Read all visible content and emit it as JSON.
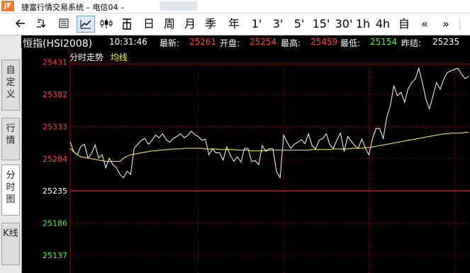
{
  "window": {
    "title": "捷富行情交易系统 – 电信04 – ",
    "logo": "JF"
  },
  "toolbar": {
    "items": [
      {
        "name": "back-arrow-icon",
        "label": "←"
      },
      {
        "name": "shortcut-icon",
        "label": ""
      },
      {
        "name": "list-icon",
        "label": ""
      },
      {
        "name": "minute-chart-icon",
        "label": ""
      },
      {
        "name": "kline-icon",
        "label": ""
      },
      {
        "name": "quote-icon",
        "label": ""
      },
      {
        "name": "day-button",
        "label": "日"
      },
      {
        "name": "week-button",
        "label": "周"
      },
      {
        "name": "month-button",
        "label": "月"
      },
      {
        "name": "season-button",
        "label": "季"
      },
      {
        "name": "year-button",
        "label": "年"
      },
      {
        "name": "1min-button",
        "label": "1'"
      },
      {
        "name": "3min-button",
        "label": "3'"
      },
      {
        "name": "5min-button",
        "label": "5'"
      },
      {
        "name": "15min-button",
        "label": "15'"
      },
      {
        "name": "30min-button",
        "label": "30'"
      },
      {
        "name": "1h-button",
        "label": "1h"
      },
      {
        "name": "4h-button",
        "label": "4h"
      },
      {
        "name": "custom-button",
        "label": "自"
      },
      {
        "name": "prev-icon",
        "label": "«"
      },
      {
        "name": "next-icon",
        "label": "»"
      }
    ]
  },
  "info": {
    "instrument": "恒指(HSI2008)",
    "time": "10:31:46",
    "latest_label": "最新:",
    "latest": "25261",
    "open_label": "开盘:",
    "open": "25254",
    "high_label": "最高:",
    "high": "25459",
    "low_label": "最低:",
    "low": "25154",
    "prev_close_label": "昨结:",
    "prev_close": "25235"
  },
  "subheader": {
    "title": "分时走势",
    "avg_label": "均线"
  },
  "sidebar": {
    "tabs": [
      {
        "label": "自定义",
        "active": false
      },
      {
        "label": "行情",
        "active": false
      },
      {
        "label": "分时图",
        "active": true
      },
      {
        "label": "K线",
        "active": false
      }
    ]
  },
  "colors": {
    "up": "#ff4040",
    "down": "#40ff40",
    "neutral": "#ffffff",
    "price_line": "#ffffff",
    "avg_line": "#ffff40",
    "grid": "#a00000",
    "baseline": "#ff0000"
  },
  "chart_data": {
    "type": "line",
    "ylim": [
      25110,
      25448
    ],
    "y_ticks": [
      "25431",
      "25382",
      "25333",
      "25284",
      "25235",
      "25186",
      "25137"
    ],
    "y_tick_values": [
      25431,
      25382,
      25333,
      25284,
      25235,
      25186,
      25137
    ],
    "baseline": 25235,
    "x": [
      0,
      5,
      10,
      15,
      20,
      25,
      30,
      35,
      40,
      45,
      50,
      55,
      60,
      65,
      70,
      75,
      80,
      85,
      90,
      95,
      100,
      105,
      110,
      115,
      120,
      125,
      130,
      135,
      140,
      145,
      150,
      155,
      160,
      165,
      170,
      175,
      180,
      185,
      190,
      195,
      200,
      205,
      210,
      215,
      220,
      225,
      230,
      235,
      240,
      245,
      250,
      255,
      260,
      265,
      270,
      275,
      280,
      285,
      290,
      295,
      300,
      305,
      310,
      315,
      320,
      325,
      330,
      335,
      340,
      345,
      350,
      355,
      360,
      365,
      370,
      375,
      380,
      385,
      390,
      395,
      400,
      405,
      410,
      415,
      420,
      425,
      430,
      435,
      440,
      445,
      450,
      455,
      460,
      465,
      470,
      475,
      480,
      485,
      490,
      495,
      500,
      505,
      510,
      515,
      520,
      525,
      530,
      535,
      540,
      545,
      550,
      555,
      560
    ],
    "series": [
      {
        "values": [
          25310,
          25295,
          25290,
          25303,
          25306,
          25285,
          25292,
          25305,
          25285,
          25290,
          25270,
          25285,
          25275,
          25270,
          25260,
          25255,
          25265,
          25260,
          25300,
          25306,
          25312,
          25315,
          25306,
          25312,
          25320,
          25316,
          25322,
          25313,
          25309,
          25315,
          25318,
          25322,
          25316,
          25319,
          25326,
          25321,
          25318,
          25312,
          25314,
          25290,
          25299,
          25293,
          25293,
          25282,
          25302,
          25290,
          25280,
          25287,
          25279,
          25300,
          25300,
          25280,
          25281,
          25275,
          25304,
          25295,
          25300,
          25299,
          25265,
          25255,
          25320,
          25309,
          25300,
          25306,
          25309,
          25313,
          25307,
          25322,
          25304,
          25299,
          25312,
          25315,
          25322,
          25305,
          25300,
          25313,
          25323,
          25295,
          25318,
          25311,
          25304,
          25300,
          25314,
          25300,
          25290,
          25315,
          25330,
          25330,
          25315,
          25347,
          25365,
          25395,
          25380,
          25385,
          25370,
          25390,
          25400,
          25405,
          25422,
          25400,
          25375,
          25360,
          25380,
          25400,
          25390,
          25405,
          25415,
          25418,
          25420,
          25422,
          25413,
          25406,
          25409
        ],
        "color": "#ffffff"
      },
      {
        "values": [
          25300,
          25295,
          25290,
          25287,
          25286,
          25285,
          25284,
          25283,
          25282,
          25281,
          25280,
          25280,
          25280,
          25280,
          25280,
          25285,
          25288,
          25290,
          25291,
          25292,
          25293,
          25294,
          25295,
          25296,
          25296,
          25297,
          25297,
          25298,
          25298,
          25299,
          25299,
          25299,
          25300,
          25300,
          25300,
          25300,
          25300,
          25300,
          25299,
          25299,
          25299,
          25299,
          25298,
          25298,
          25298,
          25298,
          25298,
          25297,
          25297,
          25297,
          25297,
          25296,
          25296,
          25296,
          25296,
          25297,
          25297,
          25297,
          25297,
          25297,
          25297,
          25297,
          25297,
          25297,
          25297,
          25297,
          25297,
          25297,
          25298,
          25298,
          25298,
          25298,
          25298,
          25298,
          25299,
          25299,
          25299,
          25299,
          25299,
          25300,
          25300,
          25300,
          25300,
          25301,
          25301,
          25302,
          25303,
          25304,
          25305,
          25306,
          25307,
          25308,
          25309,
          25310,
          25311,
          25312,
          25313,
          25314,
          25315,
          25316,
          25317,
          25318,
          25319,
          25320,
          25321,
          25322,
          25322,
          25323,
          25323,
          25323,
          25323,
          25324,
          25324
        ],
        "color": "#ffff40"
      }
    ]
  }
}
